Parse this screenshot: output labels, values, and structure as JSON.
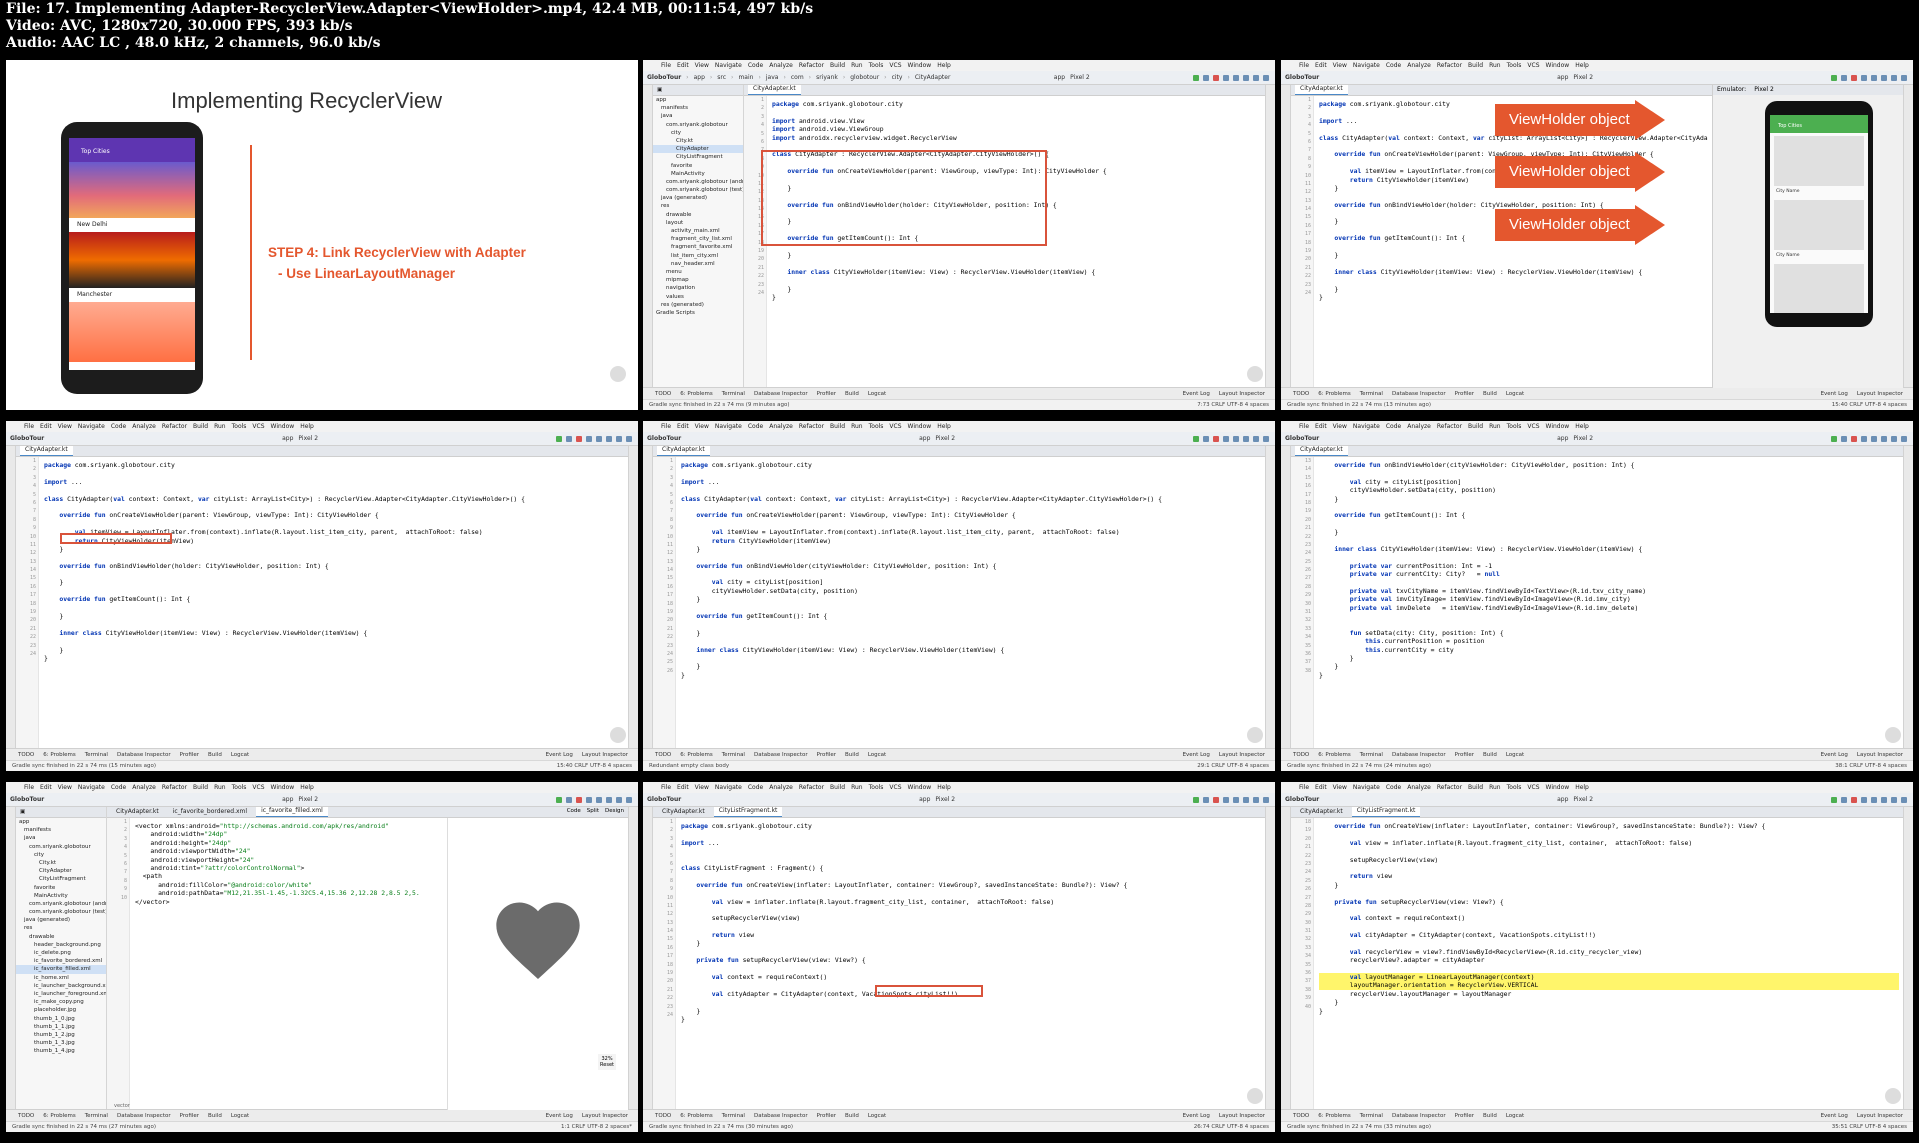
{
  "header": {
    "file_line": "File: 17. Implementing Adapter-RecyclerView.Adapter<ViewHolder>.mp4, 42.4 MB, 00:11:54, 497 kb/s",
    "video_line": "Video: AVC, 1280x720, 30.000 FPS, 393 kb/s",
    "audio_line": "Audio: AAC LC , 48.0 kHz, 2 channels, 96.0 kb/s"
  },
  "ide": {
    "menu": [
      "File",
      "Edit",
      "View",
      "Navigate",
      "Code",
      "Analyze",
      "Refactor",
      "Build",
      "Run",
      "Tools",
      "VCS",
      "Window",
      "Help"
    ],
    "project": "GloboTour",
    "run_config": "app",
    "device": "Pixel 2",
    "bottom_tools": [
      "TODO",
      "6: Problems",
      "Terminal",
      "Database Inspector",
      "Profiler",
      "Build",
      "Logcat"
    ],
    "bottom_right": [
      "Event Log",
      "Layout Inspector"
    ]
  },
  "slide": {
    "title": "Implementing RecyclerView",
    "step": "STEP 4: Link RecyclerView with Adapter",
    "substep": "- Use LinearLayoutManager",
    "phone_toolbar": "Top Cities",
    "city1": "New Delhi",
    "city2": "Manchester"
  },
  "panels": {
    "p2": {
      "tab": "CityAdapter.kt",
      "breadcrumb": [
        "GloboTour",
        "app",
        "src",
        "main",
        "java",
        "com",
        "sriyank",
        "globotour",
        "city",
        "CityAdapter"
      ],
      "tree": [
        "app",
        "manifests",
        "java",
        "com.sriyank.globotour",
        "city",
        "City.kt",
        "CityAdapter",
        "CityListFragment",
        "favorite",
        "MainActivity",
        "com.sriyank.globotour (androidTest)",
        "com.sriyank.globotour (test)",
        "java (generated)",
        "res",
        "drawable",
        "layout",
        "activity_main.xml",
        "fragment_city_list.xml",
        "fragment_favorite.xml",
        "list_item_city.xml",
        "nav_header.xml",
        "menu",
        "mipmap",
        "navigation",
        "values",
        "res (generated)",
        "Gradle Scripts"
      ],
      "code": [
        "package com.sriyank.globotour.city",
        "",
        "import android.view.View",
        "import android.view.ViewGroup",
        "import androidx.recyclerview.widget.RecyclerView",
        "",
        "class CityAdapter : RecyclerView.Adapter<CityAdapter.CityViewHolder>() {",
        "",
        "    override fun onCreateViewHolder(parent: ViewGroup, viewType: Int): CityViewHolder {",
        "",
        "    }",
        "",
        "    override fun onBindViewHolder(holder: CityViewHolder, position: Int) {",
        "",
        "    }",
        "",
        "    override fun getItemCount(): Int {",
        "",
        "    }",
        "",
        "    inner class CityViewHolder(itemView: View) : RecyclerView.ViewHolder(itemView) {",
        "",
        "    }",
        "}"
      ],
      "status_left": "Gradle sync finished in 22 s 74 ms (9 minutes ago)",
      "status_right": "7:73   CRLF   UTF-8   4 spaces"
    },
    "p3": {
      "tab": "CityAdapter.kt",
      "emulator": "Emulator:",
      "emu_device": "Pixel 2",
      "code": [
        "package com.sriyank.globotour.city",
        "",
        "import ...",
        "",
        "class CityAdapter(val context: Context, var cityList: ArrayList<City>) : RecyclerView.Adapter<CityAda",
        "",
        "    override fun onCreateViewHolder(parent: ViewGroup, viewType: Int): CityViewHolder {",
        "",
        "        val itemView = LayoutInflater.from(context).infl",
        "        return CityViewHolder(itemView)",
        "    }",
        "",
        "    override fun onBindViewHolder(holder: CityViewHolder, position: Int) {",
        "",
        "    }",
        "",
        "    override fun getItemCount(): Int {",
        "",
        "    }",
        "",
        "    inner class CityViewHolder(itemView: View) : RecyclerView.ViewHolder(itemView) {",
        "",
        "    }",
        "}"
      ],
      "arrows": [
        "ViewHolder object",
        "ViewHolder object",
        "ViewHolder object"
      ],
      "phone_toolbar": "Top Cities",
      "city_label": "City Name",
      "status_left": "Gradle sync finished in 22 s 74 ms (13 minutes ago)",
      "status_right": "15:40   CRLF   UTF-8   4 spaces"
    },
    "p4": {
      "tab": "CityAdapter.kt",
      "code": [
        "package com.sriyank.globotour.city",
        "",
        "import ...",
        "",
        "class CityAdapter(val context: Context, var cityList: ArrayList<City>) : RecyclerView.Adapter<CityAdapter.CityViewHolder>() {",
        "",
        "    override fun onCreateViewHolder(parent: ViewGroup, viewType: Int): CityViewHolder {",
        "",
        "        val itemView = LayoutInflater.from(context).inflate(R.layout.list_item_city, parent,  attachToRoot: false)",
        "        return CityViewHolder(itemView)",
        "    }",
        "",
        "    override fun onBindViewHolder(holder: CityViewHolder, position: Int) {",
        "",
        "    }",
        "",
        "    override fun getItemCount(): Int {",
        "",
        "    }",
        "",
        "    inner class CityViewHolder(itemView: View) : RecyclerView.ViewHolder(itemView) {",
        "",
        "    }",
        "}"
      ],
      "status_left": "Gradle sync finished in 22 s 74 ms (15 minutes ago)",
      "status_right": "15:40   CRLF   UTF-8   4 spaces"
    },
    "p5": {
      "tab": "CityAdapter.kt",
      "code": [
        "package com.sriyank.globotour.city",
        "",
        "import ...",
        "",
        "class CityAdapter(val context: Context, var cityList: ArrayList<City>) : RecyclerView.Adapter<CityAdapter.CityViewHolder>() {",
        "",
        "    override fun onCreateViewHolder(parent: ViewGroup, viewType: Int): CityViewHolder {",
        "",
        "        val itemView = LayoutInflater.from(context).inflate(R.layout.list_item_city, parent,  attachToRoot: false)",
        "        return CityViewHolder(itemView)",
        "    }",
        "",
        "    override fun onBindViewHolder(cityViewHolder: CityViewHolder, position: Int) {",
        "",
        "        val city = cityList[position]",
        "        cityViewHolder.setData(city, position)",
        "    }",
        "",
        "    override fun getItemCount(): Int {",
        "",
        "    }",
        "",
        "    inner class CityViewHolder(itemView: View) : RecyclerView.ViewHolder(itemView) {",
        "",
        "    }",
        "}"
      ],
      "status_left": "Redundant empty class body",
      "status_right": "29:1   CRLF   UTF-8   4 spaces"
    },
    "p6": {
      "tab": "CityAdapter.kt",
      "code": [
        "    override fun onBindViewHolder(cityViewHolder: CityViewHolder, position: Int) {",
        "",
        "        val city = cityList[position]",
        "        cityViewHolder.setData(city, position)",
        "    }",
        "",
        "    override fun getItemCount(): Int {",
        "",
        "    }",
        "",
        "    inner class CityViewHolder(itemView: View) : RecyclerView.ViewHolder(itemView) {",
        "",
        "        private var currentPosition: Int = -1",
        "        private var currentCity: City?   = null",
        "",
        "        private val txvCityName = itemView.findViewById<TextView>(R.id.txv_city_name)",
        "        private val imvCityImage= itemView.findViewById<ImageView>(R.id.imv_city)",
        "        private val imvDelete   = itemView.findViewById<ImageView>(R.id.imv_delete)",
        "",
        "",
        "        fun setData(city: City, position: Int) {",
        "            this.currentPosition = position",
        "            this.currentCity = city",
        "        }",
        "    }",
        "}"
      ],
      "status_left": "Gradle sync finished in 22 s 74 ms (24 minutes ago)",
      "status_right": "38:1   CRLF   UTF-8   4 spaces"
    },
    "p7": {
      "tabs": [
        "CityAdapter.kt",
        "ic_favorite_bordered.xml",
        "ic_favorite_filled.xml"
      ],
      "tree": [
        "app",
        "manifests",
        "java",
        "com.sriyank.globotour",
        "city",
        "City.kt",
        "CityAdapter",
        "CityListFragment",
        "favorite",
        "MainActivity",
        "com.sriyank.globotour (androidTest)",
        "com.sriyank.globotour (test)",
        "java (generated)",
        "res",
        "drawable",
        "header_background.png",
        "ic_delete.png",
        "ic_favorite_bordered.xml",
        "ic_favorite_filled.xml",
        "ic_home.xml",
        "ic_launcher_background.xml",
        "ic_launcher_foreground.xml",
        "ic_make_copy.png",
        "placeholder.jpg",
        "thumb_1_0.jpg",
        "thumb_1_1.jpg",
        "thumb_1_2.jpg",
        "thumb_1_3.jpg",
        "thumb_1_4.jpg"
      ],
      "code": [
        "<vector xmlns:android=\"http://schemas.android.com/apk/res/android\"",
        "    android:width=\"24dp\"",
        "    android:height=\"24dp\"",
        "    android:viewportWidth=\"24\"",
        "    android:viewportHeight=\"24\"",
        "    android:tint=\"?attr/colorControlNormal\">",
        "  <path",
        "      android:fillColor=\"@android:color/white\"",
        "      android:pathData=\"M12,21.35l-1.45,-1.32C5.4,15.36 2,12.28 2,8.5 2,5.",
        "</vector>"
      ],
      "modes": [
        "Code",
        "Split",
        "Design"
      ],
      "zoom": "32%",
      "reset": "Reset",
      "crumb_bottom": "vector",
      "status_left": "Gradle sync finished in 22 s 74 ms (27 minutes ago)",
      "status_right": "1:1   CRLF   UTF-8   2 spaces*"
    },
    "p8": {
      "tabs": [
        "CityAdapter.kt",
        "CityListFragment.kt"
      ],
      "code": [
        "package com.sriyank.globotour.city",
        "",
        "import ...",
        "",
        "",
        "class CityListFragment : Fragment() {",
        "",
        "    override fun onCreateView(inflater: LayoutInflater, container: ViewGroup?, savedInstanceState: Bundle?): View? {",
        "",
        "        val view = inflater.inflate(R.layout.fragment_city_list, container,  attachToRoot: false)",
        "",
        "        setupRecyclerView(view)",
        "",
        "        return view",
        "    }",
        "",
        "    private fun setupRecyclerView(view: View?) {",
        "",
        "        val context = requireContext()",
        "",
        "        val cityAdapter = CityAdapter(context, VacationSpots.cityList!!)",
        "",
        "    }",
        "}"
      ],
      "status_left": "Gradle sync finished in 22 s 74 ms (30 minutes ago)",
      "status_right": "26:74   CRLF   UTF-8   4 spaces"
    },
    "p9": {
      "tabs": [
        "CityAdapter.kt",
        "CityListFragment.kt"
      ],
      "code": [
        "    override fun onCreateView(inflater: LayoutInflater, container: ViewGroup?, savedInstanceState: Bundle?): View? {",
        "",
        "        val view = inflater.inflate(R.layout.fragment_city_list, container,  attachToRoot: false)",
        "",
        "        setupRecyclerView(view)",
        "",
        "        return view",
        "    }",
        "",
        "    private fun setupRecyclerView(view: View?) {",
        "",
        "        val context = requireContext()",
        "",
        "        val cityAdapter = CityAdapter(context, VacationSpots.cityList!!)",
        "",
        "        val recyclerView = view?.findViewById<RecyclerView>(R.id.city_recycler_view)",
        "        recyclerView?.adapter = cityAdapter",
        "",
        "        val layoutManager = LinearLayoutManager(context)",
        "        layoutManager.orientation = RecyclerView.VERTICAL",
        "        recyclerView.layoutManager = layoutManager",
        "    }",
        "}"
      ],
      "status_left": "Gradle sync finished in 22 s 74 ms (33 minutes ago)",
      "status_right": "35:51   CRLF   UTF-8   4 spaces"
    }
  },
  "colors": {
    "accent_orange": "#e4572e",
    "keyword": "#0033b3",
    "string": "#067d17",
    "phone_purple": "#5e35b1",
    "phone_green": "#4caf50"
  }
}
